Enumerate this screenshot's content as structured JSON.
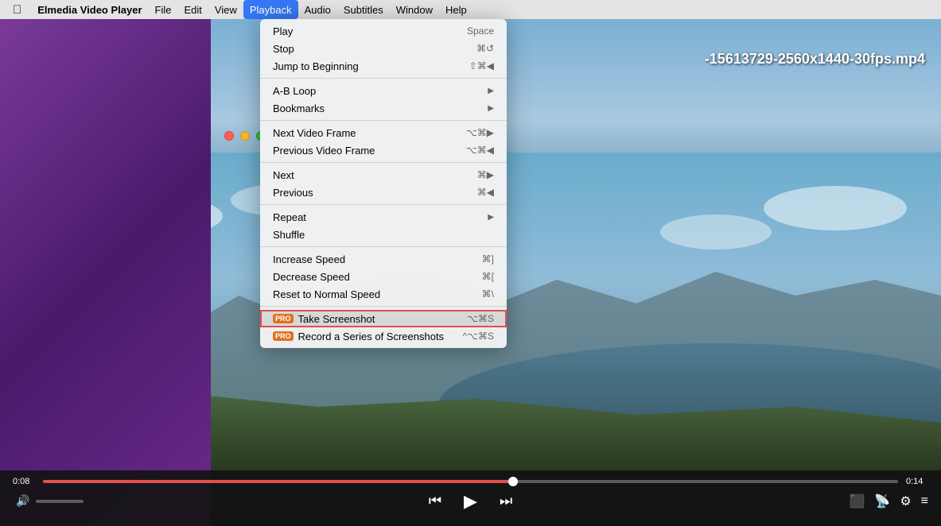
{
  "menubar": {
    "apple_label": "",
    "app_name": "Elmedia Video Player",
    "items": [
      {
        "label": "File",
        "id": "file"
      },
      {
        "label": "Edit",
        "id": "edit"
      },
      {
        "label": "View",
        "id": "view"
      },
      {
        "label": "Playback",
        "id": "playback"
      },
      {
        "label": "Audio",
        "id": "audio"
      },
      {
        "label": "Subtitles",
        "id": "subtitles"
      },
      {
        "label": "Window",
        "id": "window"
      },
      {
        "label": "Help",
        "id": "help"
      }
    ],
    "active": "playback"
  },
  "window": {
    "title": "Elmedia Video Player"
  },
  "video": {
    "filename": "-15613729-2560x1440-30fps.mp4"
  },
  "playback_menu": {
    "items": [
      {
        "label": "Play",
        "shortcut": "Space",
        "type": "item",
        "id": "play"
      },
      {
        "label": "Stop",
        "shortcut": "⌘↺",
        "type": "item",
        "id": "stop"
      },
      {
        "label": "Jump to Beginning",
        "shortcut": "⇧⌘◀",
        "type": "item",
        "id": "jump-to-beginning"
      },
      {
        "separator": true
      },
      {
        "label": "A-B Loop",
        "shortcut": "",
        "type": "submenu",
        "id": "ab-loop"
      },
      {
        "label": "Bookmarks",
        "shortcut": "",
        "type": "submenu",
        "id": "bookmarks"
      },
      {
        "separator": true
      },
      {
        "label": "Next Video Frame",
        "shortcut": "⌥⌘▶",
        "type": "item",
        "id": "next-video-frame"
      },
      {
        "label": "Previous Video Frame",
        "shortcut": "⌥⌘◀",
        "type": "item",
        "id": "previous-video-frame"
      },
      {
        "separator": true
      },
      {
        "label": "Next",
        "shortcut": "⌘▶",
        "type": "item",
        "id": "next"
      },
      {
        "label": "Previous",
        "shortcut": "⌘◀",
        "type": "item",
        "id": "previous"
      },
      {
        "separator": true
      },
      {
        "label": "Repeat",
        "shortcut": "",
        "type": "submenu",
        "id": "repeat"
      },
      {
        "label": "Shuffle",
        "shortcut": "",
        "type": "item",
        "id": "shuffle"
      },
      {
        "separator": true
      },
      {
        "label": "Increase Speed",
        "shortcut": "⌘]",
        "type": "item",
        "id": "increase-speed"
      },
      {
        "label": "Decrease Speed",
        "shortcut": "⌘[",
        "type": "item",
        "id": "decrease-speed"
      },
      {
        "label": "Reset to Normal Speed",
        "shortcut": "⌘\\",
        "type": "item",
        "id": "reset-speed"
      },
      {
        "separator": true
      },
      {
        "label": "Take Screenshot",
        "shortcut": "⌥⌘S",
        "type": "item",
        "pro": true,
        "id": "take-screenshot",
        "highlighted": true
      },
      {
        "label": "Record a Series of Screenshots",
        "shortcut": "^⌥⌘S",
        "type": "item",
        "pro": true,
        "id": "record-screenshots"
      }
    ]
  },
  "controls": {
    "time_current": "0:08",
    "time_total": "0:14",
    "play_btn": "▶",
    "prev_btn": "⏮",
    "next_btn": "⏭",
    "volume_icon": "🔊",
    "pro_label": "PRO"
  }
}
